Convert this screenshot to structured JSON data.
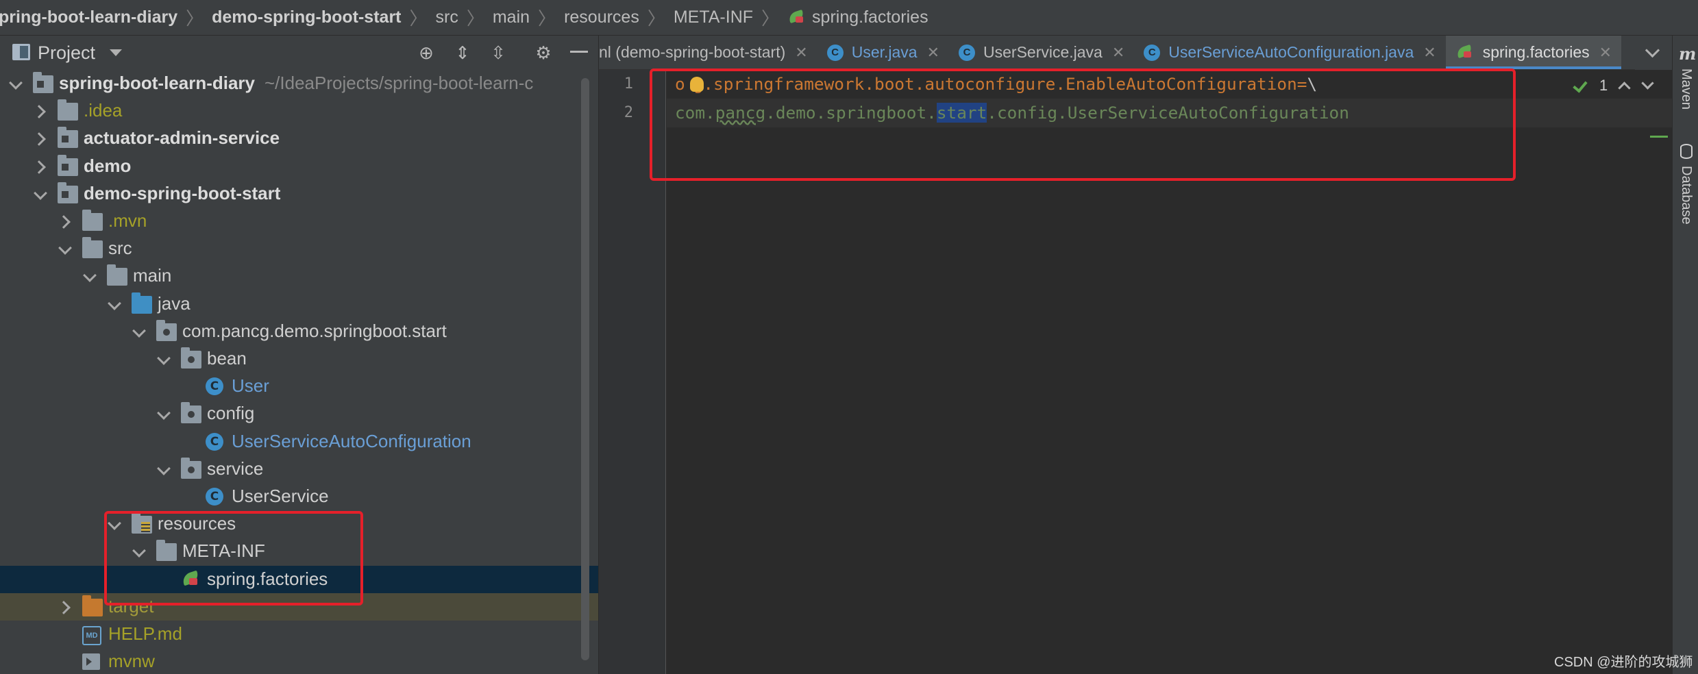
{
  "breadcrumb": [
    {
      "label": "pring-boot-learn-diary",
      "bold": true
    },
    {
      "label": "demo-spring-boot-start",
      "bold": true
    },
    {
      "label": "src",
      "bold": false
    },
    {
      "label": "main",
      "bold": false
    },
    {
      "label": "resources",
      "bold": false
    },
    {
      "label": "META-INF",
      "bold": false
    },
    {
      "label": "spring.factories",
      "bold": false,
      "icon": "spring-factories-icon"
    }
  ],
  "project_panel": {
    "title": "Project",
    "toolbar_icons": [
      "locate-icon",
      "expand-all-icon",
      "collapse-all-icon",
      "gear-icon",
      "hide-icon"
    ]
  },
  "tree": [
    {
      "label": "spring-boot-learn-diary",
      "hint": "~/IdeaProjects/spring-boot-learn-c",
      "depth": 0,
      "arrow": "down",
      "icon": "module",
      "style": "bold"
    },
    {
      "label": ".idea",
      "depth": 1,
      "arrow": "right",
      "icon": "folder",
      "style": "excluded"
    },
    {
      "label": "actuator-admin-service",
      "depth": 1,
      "arrow": "right",
      "icon": "module",
      "style": "bold"
    },
    {
      "label": "demo",
      "depth": 1,
      "arrow": "right",
      "icon": "module",
      "style": "bold"
    },
    {
      "label": "demo-spring-boot-start",
      "depth": 1,
      "arrow": "down",
      "icon": "module",
      "style": "bold"
    },
    {
      "label": ".mvn",
      "depth": 2,
      "arrow": "right",
      "icon": "folder",
      "style": "excluded"
    },
    {
      "label": "src",
      "depth": 2,
      "arrow": "down",
      "icon": "folder",
      "style": "default"
    },
    {
      "label": "main",
      "depth": 3,
      "arrow": "down",
      "icon": "folder",
      "style": "default"
    },
    {
      "label": "java",
      "depth": 4,
      "arrow": "down",
      "icon": "folder-blue",
      "style": "default"
    },
    {
      "label": "com.pancg.demo.springboot.start",
      "depth": 5,
      "arrow": "down",
      "icon": "package",
      "style": "default"
    },
    {
      "label": "bean",
      "depth": 6,
      "arrow": "down",
      "icon": "package",
      "style": "default"
    },
    {
      "label": "User",
      "depth": 7,
      "arrow": "",
      "icon": "class",
      "style": "blue"
    },
    {
      "label": "config",
      "depth": 6,
      "arrow": "down",
      "icon": "package",
      "style": "default"
    },
    {
      "label": "UserServiceAutoConfiguration",
      "depth": 7,
      "arrow": "",
      "icon": "class",
      "style": "blue"
    },
    {
      "label": "service",
      "depth": 6,
      "arrow": "down",
      "icon": "package",
      "style": "default"
    },
    {
      "label": "UserService",
      "depth": 7,
      "arrow": "",
      "icon": "class",
      "style": "default"
    },
    {
      "label": "resources",
      "depth": 4,
      "arrow": "down",
      "icon": "resources",
      "style": "default"
    },
    {
      "label": "META-INF",
      "depth": 5,
      "arrow": "down",
      "icon": "folder",
      "style": "default"
    },
    {
      "label": "spring.factories",
      "depth": 6,
      "arrow": "",
      "icon": "spring",
      "style": "default",
      "selected": true
    },
    {
      "label": "target",
      "depth": 2,
      "arrow": "right",
      "icon": "folder-orange",
      "style": "olive",
      "ignored": true
    },
    {
      "label": "HELP.md",
      "depth": 2,
      "arrow": "",
      "icon": "markdown",
      "style": "excluded"
    },
    {
      "label": "mvnw",
      "depth": 2,
      "arrow": "",
      "icon": "shell",
      "style": "excluded"
    }
  ],
  "tabs": [
    {
      "label": "nl (demo-spring-boot-start)",
      "icon": "",
      "name_style": "default",
      "active": false
    },
    {
      "label": "User.java",
      "icon": "class",
      "name_style": "blue",
      "active": false
    },
    {
      "label": "UserService.java",
      "icon": "class",
      "name_style": "default",
      "active": false
    },
    {
      "label": "UserServiceAutoConfiguration.java",
      "icon": "class",
      "name_style": "blue",
      "active": false
    },
    {
      "label": "spring.factories",
      "icon": "spring",
      "name_style": "default",
      "active": true
    }
  ],
  "tab_close_glyph": "✕",
  "class_icon_letter": "C",
  "markdown_icon_text": "MD",
  "editor": {
    "line_numbers": [
      "1",
      "2"
    ],
    "line1": {
      "pre_bulb": "o",
      "post_bulb": "g.springframework.boot.autoconfigure.EnableAutoConfiguration",
      "equals": "=",
      "backslash": "\\"
    },
    "line2": {
      "part1": "com.",
      "typo": "pancg",
      "part2": ".demo.springboot.",
      "selected": "start",
      "part3": ".config.UserServiceAutoConfiguration"
    },
    "inspection_count": "1"
  },
  "right_strip": {
    "maven_label": "Maven",
    "maven_icon_glyph": "m",
    "database_label": "Database"
  },
  "watermark": "CSDN @进阶的攻城狮",
  "colors": {
    "highlight_box": "#e5202a",
    "keyword_orange": "#cc7832",
    "string_green": "#6a8759",
    "selection_blue": "#214283",
    "class_blue": "#3d8fc9"
  }
}
